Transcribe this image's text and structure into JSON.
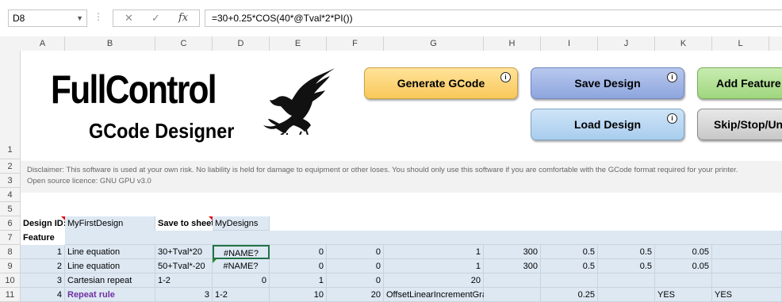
{
  "formula_bar": {
    "name_box": "D8",
    "cancel_glyph": "✕",
    "enter_glyph": "✓",
    "fx_glyph": "fx",
    "formula": "=30+0.25*COS(40*@Tval*2*PI())"
  },
  "columns": [
    "A",
    "B",
    "C",
    "D",
    "E",
    "F",
    "G",
    "H",
    "I",
    "J",
    "K",
    "L"
  ],
  "rows": [
    "1",
    "2",
    "3",
    "4",
    "5",
    "6",
    "7",
    "8",
    "9",
    "10",
    "11"
  ],
  "logo": {
    "title": "FullControl",
    "subtitle": "GCode Designer",
    "icon": "eagle-icon"
  },
  "buttons": {
    "generate": "Generate GCode",
    "save": "Save Design",
    "add": "Add Feature",
    "load": "Load Design",
    "skip": "Skip/Stop/Unskip",
    "info_glyph": "i"
  },
  "disclaimer": {
    "line1": "Disclaimer: This software is used at your own risk. No liability is held for damage to equipment or other loses. You should only use this software if you are comfortable with the GCode format required for your printer.",
    "line2": "Open source licence: GNU GPU v3.0"
  },
  "sheet": {
    "design_id_label": "Design ID:",
    "design_id_value": "MyFirstDesign",
    "save_to_label": "Save to sheet:",
    "save_to_value": "MyDesigns",
    "feature_header": "Feature",
    "rows": [
      {
        "a": "1",
        "b": "Line equation",
        "c": "30+Tval*20",
        "d": "#NAME?",
        "e": "0",
        "f": "0",
        "g": "1",
        "h": "300",
        "i": "0.5",
        "j": "0.5",
        "k": "0.05",
        "l": ""
      },
      {
        "a": "2",
        "b": "Line equation",
        "c": "50+Tval*-20",
        "d": "#NAME?",
        "e": "0",
        "f": "0",
        "g": "1",
        "h": "300",
        "i": "0.5",
        "j": "0.5",
        "k": "0.05",
        "l": ""
      },
      {
        "a": "3",
        "b": "Cartesian repeat",
        "c": "1-2",
        "d": "0",
        "e": "1",
        "f": "0",
        "g": "20",
        "h": "",
        "i": "",
        "j": "",
        "k": "",
        "l": ""
      },
      {
        "a": "4",
        "b": "Repeat rule",
        "c": "3",
        "d": "1-2",
        "e": "10",
        "f": "20",
        "g": "OffsetLinearIncrementGraded",
        "h": "",
        "i": "0.25",
        "j": "",
        "k": "YES",
        "l": "YES"
      }
    ]
  },
  "colors": {
    "generate_button": "#f9c85a",
    "save_button": "#8ea6de",
    "add_button": "#9fd67e",
    "load_button": "#a8cdee",
    "skip_button": "#c8c8c8",
    "table_fill": "#dde8f3",
    "repeat_rule_text": "#7030a0"
  }
}
